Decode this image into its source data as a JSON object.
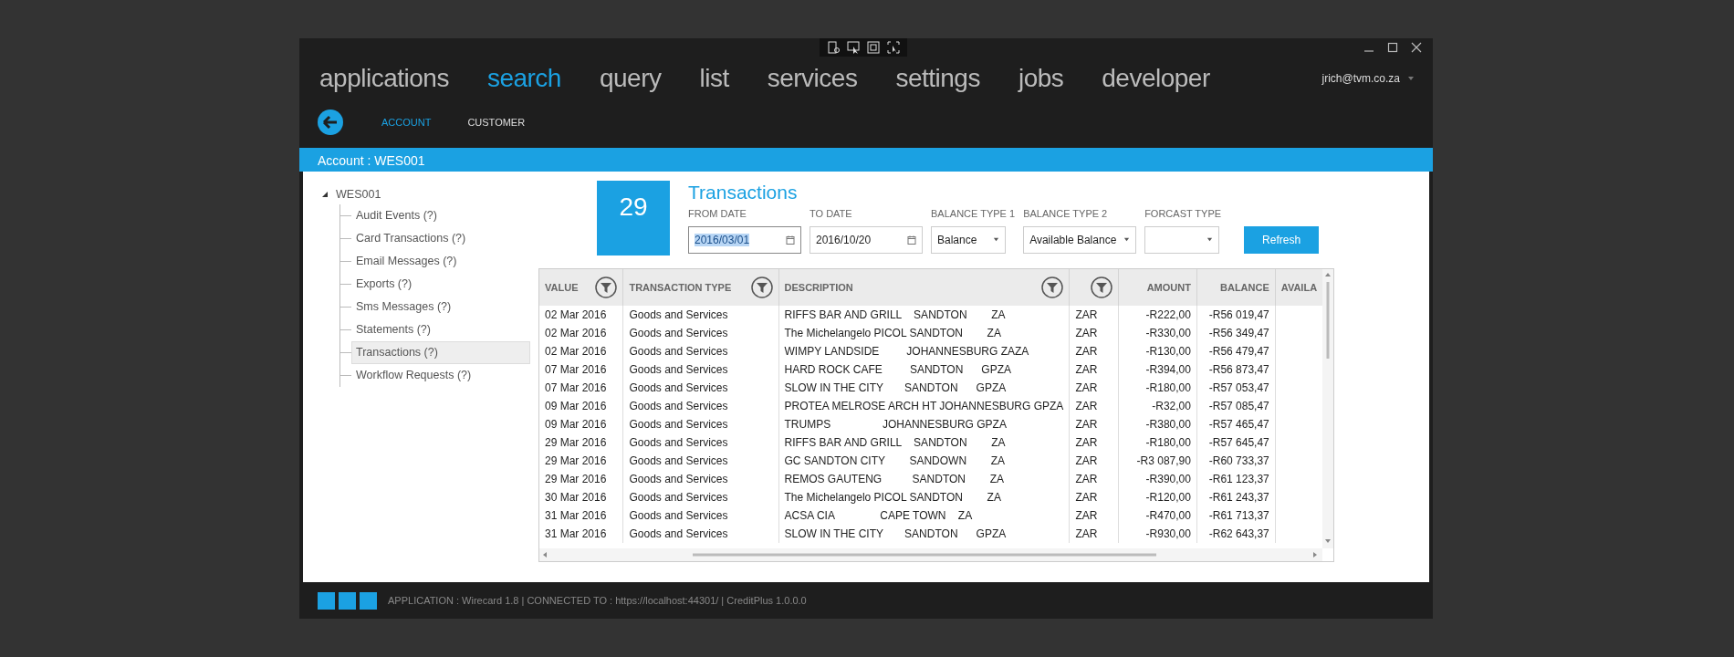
{
  "nav": [
    {
      "label": "applications",
      "selected": false
    },
    {
      "label": "search",
      "selected": true
    },
    {
      "label": "query",
      "selected": false
    },
    {
      "label": "list",
      "selected": false
    },
    {
      "label": "services",
      "selected": false
    },
    {
      "label": "settings",
      "selected": false
    },
    {
      "label": "jobs",
      "selected": false
    },
    {
      "label": "developer",
      "selected": false
    }
  ],
  "user": {
    "email": "jrich@tvm.co.za"
  },
  "subtabs": [
    {
      "label": "ACCOUNT",
      "selected": true
    },
    {
      "label": "CUSTOMER",
      "selected": false
    }
  ],
  "account_bar": {
    "title": "Account : WES001"
  },
  "tree": {
    "label": "WES001",
    "expanded": true,
    "children": [
      {
        "label": "Audit Events (?)",
        "selected": false
      },
      {
        "label": "Card Transactions (?)",
        "selected": false
      },
      {
        "label": "Email Messages (?)",
        "selected": false
      },
      {
        "label": "Exports (?)",
        "selected": false
      },
      {
        "label": "Sms Messages (?)",
        "selected": false
      },
      {
        "label": "Statements (?)",
        "selected": false
      },
      {
        "label": "Transactions (?)",
        "selected": true
      },
      {
        "label": "Workflow Requests (?)",
        "selected": false
      }
    ]
  },
  "panel": {
    "count": "29",
    "title": "Transactions",
    "filters": [
      {
        "kind": "date",
        "label": "FROM DATE",
        "value": "2016/03/01",
        "highlighted": true
      },
      {
        "kind": "date",
        "label": "TO DATE",
        "value": "2016/10/20",
        "highlighted": false
      },
      {
        "kind": "select",
        "label": "BALANCE TYPE 1",
        "value": "Balance"
      },
      {
        "kind": "select",
        "label": "BALANCE TYPE 2",
        "value": "Available Balance"
      },
      {
        "kind": "select",
        "label": "FORCAST TYPE"
      }
    ],
    "refresh": "Refresh"
  },
  "table": {
    "columns": [
      {
        "label": "VALUE",
        "filter": true,
        "kind": "text"
      },
      {
        "label": "TRANSACTION TYPE",
        "filter": true,
        "kind": "text"
      },
      {
        "label": "DESCRIPTION",
        "filter": true,
        "kind": "text"
      },
      {
        "filter": true,
        "kind": "text"
      },
      {
        "label": "AMOUNT",
        "filter": false,
        "kind": "amount"
      },
      {
        "label": "BALANCE",
        "filter": false,
        "kind": "amount"
      },
      {
        "label": "AVAILA",
        "filter": false,
        "kind": "text"
      }
    ],
    "rows": [
      [
        "02 Mar 2016",
        "Goods and Services",
        "RIFFS BAR AND GRILL    SANDTON        ZA",
        "ZAR",
        "-R222,00",
        "-R56 019,47"
      ],
      [
        "02 Mar 2016",
        "Goods and Services",
        "The Michelangelo PICOL SANDTON        ZA",
        "ZAR",
        "-R330,00",
        "-R56 349,47"
      ],
      [
        "02 Mar 2016",
        "Goods and Services",
        "WIMPY LANDSIDE         JOHANNESBURG ZAZA",
        "ZAR",
        "-R130,00",
        "-R56 479,47"
      ],
      [
        "07 Mar 2016",
        "Goods and Services",
        "HARD ROCK CAFE         SANDTON      GPZA",
        "ZAR",
        "-R394,00",
        "-R56 873,47"
      ],
      [
        "07 Mar 2016",
        "Goods and Services",
        "SLOW IN THE CITY       SANDTON      GPZA",
        "ZAR",
        "-R180,00",
        "-R57 053,47"
      ],
      [
        "09 Mar 2016",
        "Goods and Services",
        "PROTEA MELROSE ARCH HT JOHANNESBURG GPZA",
        "ZAR",
        "-R32,00",
        "-R57 085,47"
      ],
      [
        "09 Mar 2016",
        "Goods and Services",
        "TRUMPS                 JOHANNESBURG GPZA",
        "ZAR",
        "-R380,00",
        "-R57 465,47"
      ],
      [
        "29 Mar 2016",
        "Goods and Services",
        "RIFFS BAR AND GRILL    SANDTON        ZA",
        "ZAR",
        "-R180,00",
        "-R57 645,47"
      ],
      [
        "29 Mar 2016",
        "Goods and Services",
        "GC SANDTON CITY        SANDOWN        ZA",
        "ZAR",
        "-R3 087,90",
        "-R60 733,37"
      ],
      [
        "29 Mar 2016",
        "Goods and Services",
        "REMOS GAUTENG          SANDTON        ZA",
        "ZAR",
        "-R390,00",
        "-R61 123,37"
      ],
      [
        "30 Mar 2016",
        "Goods and Services",
        "The Michelangelo PICOL SANDTON        ZA",
        "ZAR",
        "-R120,00",
        "-R61 243,37"
      ],
      [
        "31 Mar 2016",
        "Goods and Services",
        "ACSA CIA               CAPE TOWN    ZA",
        "ZAR",
        "-R470,00",
        "-R61 713,37"
      ],
      [
        "31 Mar 2016",
        "Goods and Services",
        "SLOW IN THE CITY       SANDTON      GPZA",
        "ZAR",
        "-R930,00",
        "-R62 643,37"
      ]
    ]
  },
  "status_bar": {
    "text": "APPLICATION : Wirecard 1.8 | CONNECTED TO : https://localhost:44301/ | CreditPlus 1.0.0.0"
  }
}
